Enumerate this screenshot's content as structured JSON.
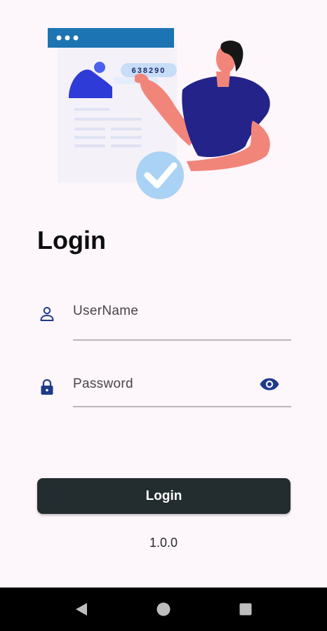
{
  "illustration": {
    "code_text": "638290"
  },
  "page": {
    "title": "Login"
  },
  "form": {
    "username": {
      "placeholder": "UserName",
      "value": ""
    },
    "password": {
      "placeholder": "Password",
      "value": ""
    }
  },
  "login_button": {
    "label": "Login"
  },
  "version": "1.0.0",
  "icons": {
    "username": "person-icon",
    "password": "lock-icon",
    "toggle": "eye-icon",
    "nav_back": "back-triangle-icon",
    "nav_home": "home-circle-icon",
    "nav_recent": "recents-square-icon"
  },
  "colors": {
    "background": "#fdf6fb",
    "accent": "#1f3a8a",
    "button": "#232d30"
  }
}
